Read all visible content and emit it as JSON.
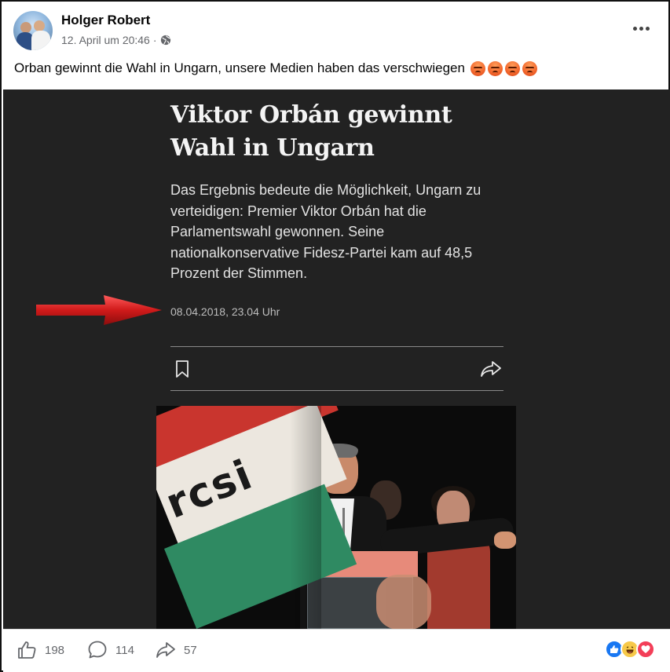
{
  "post": {
    "author": "Holger Robert",
    "timestamp": "12. April um 20:46",
    "separator": "·",
    "privacy_icon": "globe-icon",
    "more_icon": "more-options-icon",
    "text": "Orban gewinnt die Wahl in Ungarn, unsere Medien haben das verschwiegen",
    "text_emojis": [
      "angry",
      "angry",
      "angry",
      "angry"
    ]
  },
  "article": {
    "headline": "Viktor Orbán gewinnt Wahl in Ungarn",
    "teaser": "Das Ergebnis bedeute die Möglichkeit, Ungarn zu verteidigen: Premier Viktor Orbán hat die Parlamentswahl gewonnen. Seine nationalkonservative Fidesz-Partei kam auf 48,5 Prozent der Stimmen.",
    "date": "08.04.2018, 23.04 Uhr",
    "bookmark_icon": "bookmark-icon",
    "share_icon": "share-icon",
    "annotation_arrow_color": "#d01a1a",
    "background_color": "#222222",
    "photo": {
      "flag_text": "rcsi",
      "flag_colors": [
        "#c9352e",
        "#ece7df",
        "#2f8a62"
      ]
    }
  },
  "actions": {
    "likes": "198",
    "comments": "114",
    "shares": "57",
    "like_icon": "thumbs-up-icon",
    "comment_icon": "comment-icon",
    "share_icon": "share-arrow-icon",
    "reactions": [
      "like",
      "haha",
      "love"
    ]
  },
  "colors": {
    "like_blue": "#1877f2",
    "love_red": "#f33e58",
    "haha_yellow": "#f7c94a",
    "meta_gray": "#65676b"
  }
}
